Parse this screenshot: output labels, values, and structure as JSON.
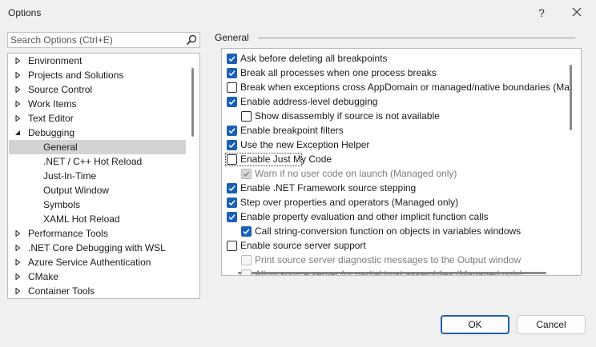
{
  "window": {
    "title": "Options",
    "help_label": "?"
  },
  "search": {
    "placeholder": "Search Options (Ctrl+E)",
    "value": ""
  },
  "tree": [
    {
      "label": "Environment",
      "level": 0,
      "state": "collapsed",
      "selected": false
    },
    {
      "label": "Projects and Solutions",
      "level": 0,
      "state": "collapsed",
      "selected": false
    },
    {
      "label": "Source Control",
      "level": 0,
      "state": "collapsed",
      "selected": false
    },
    {
      "label": "Work Items",
      "level": 0,
      "state": "collapsed",
      "selected": false
    },
    {
      "label": "Text Editor",
      "level": 0,
      "state": "collapsed",
      "selected": false
    },
    {
      "label": "Debugging",
      "level": 0,
      "state": "expanded",
      "selected": false
    },
    {
      "label": "General",
      "level": 1,
      "state": "leaf",
      "selected": true
    },
    {
      "label": ".NET / C++ Hot Reload",
      "level": 1,
      "state": "leaf",
      "selected": false
    },
    {
      "label": "Just-In-Time",
      "level": 1,
      "state": "leaf",
      "selected": false
    },
    {
      "label": "Output Window",
      "level": 1,
      "state": "leaf",
      "selected": false
    },
    {
      "label": "Symbols",
      "level": 1,
      "state": "leaf",
      "selected": false
    },
    {
      "label": "XAML Hot Reload",
      "level": 1,
      "state": "leaf",
      "selected": false
    },
    {
      "label": "Performance Tools",
      "level": 0,
      "state": "collapsed",
      "selected": false
    },
    {
      "label": ".NET Core Debugging with WSL",
      "level": 0,
      "state": "collapsed",
      "selected": false
    },
    {
      "label": "Azure Service Authentication",
      "level": 0,
      "state": "collapsed",
      "selected": false
    },
    {
      "label": "CMake",
      "level": 0,
      "state": "collapsed",
      "selected": false
    },
    {
      "label": "Container Tools",
      "level": 0,
      "state": "collapsed",
      "selected": false
    }
  ],
  "panel": {
    "title": "General",
    "options": [
      {
        "label": "Ask before deleting all breakpoints",
        "checked": true,
        "indent": 0,
        "enabled": true
      },
      {
        "label": "Break all processes when one process breaks",
        "checked": true,
        "indent": 0,
        "enabled": true
      },
      {
        "label": "Break when exceptions cross AppDomain or managed/native boundaries (Ma",
        "checked": false,
        "indent": 0,
        "enabled": true
      },
      {
        "label": "Enable address-level debugging",
        "checked": true,
        "indent": 0,
        "enabled": true
      },
      {
        "label": "Show disassembly if source is not available",
        "checked": false,
        "indent": 1,
        "enabled": true
      },
      {
        "label": "Enable breakpoint filters",
        "checked": true,
        "indent": 0,
        "enabled": true
      },
      {
        "label": "Use the new Exception Helper",
        "checked": true,
        "indent": 0,
        "enabled": true
      },
      {
        "label": "Enable Just My Code",
        "checked": false,
        "indent": 0,
        "enabled": true,
        "focused": true
      },
      {
        "label": "Warn if no user code on launch (Managed only)",
        "checked": true,
        "indent": 1,
        "enabled": false
      },
      {
        "label": "Enable .NET Framework source stepping",
        "checked": true,
        "indent": 0,
        "enabled": true
      },
      {
        "label": "Step over properties and operators (Managed only)",
        "checked": true,
        "indent": 0,
        "enabled": true
      },
      {
        "label": "Enable property evaluation and other implicit function calls",
        "checked": true,
        "indent": 0,
        "enabled": true
      },
      {
        "label": "Call string-conversion function on objects in variables windows",
        "checked": true,
        "indent": 1,
        "enabled": true
      },
      {
        "label": "Enable source server support",
        "checked": false,
        "indent": 0,
        "enabled": true
      },
      {
        "label": "Print source server diagnostic messages to the Output window",
        "checked": false,
        "indent": 1,
        "enabled": false
      },
      {
        "label": "Allow source server for partial trust assemblies (Managed only)",
        "checked": false,
        "indent": 1,
        "enabled": false
      }
    ]
  },
  "buttons": {
    "ok": "OK",
    "cancel": "Cancel"
  },
  "colors": {
    "accent": "#1c5fb6",
    "selection": "#d3d3d3",
    "background": "#f0f0f0"
  },
  "icons": {
    "search": "search-icon",
    "close": "close-icon",
    "collapsed": "triangle-right-icon",
    "expanded": "triangle-down-icon",
    "check": "checkmark-icon"
  }
}
